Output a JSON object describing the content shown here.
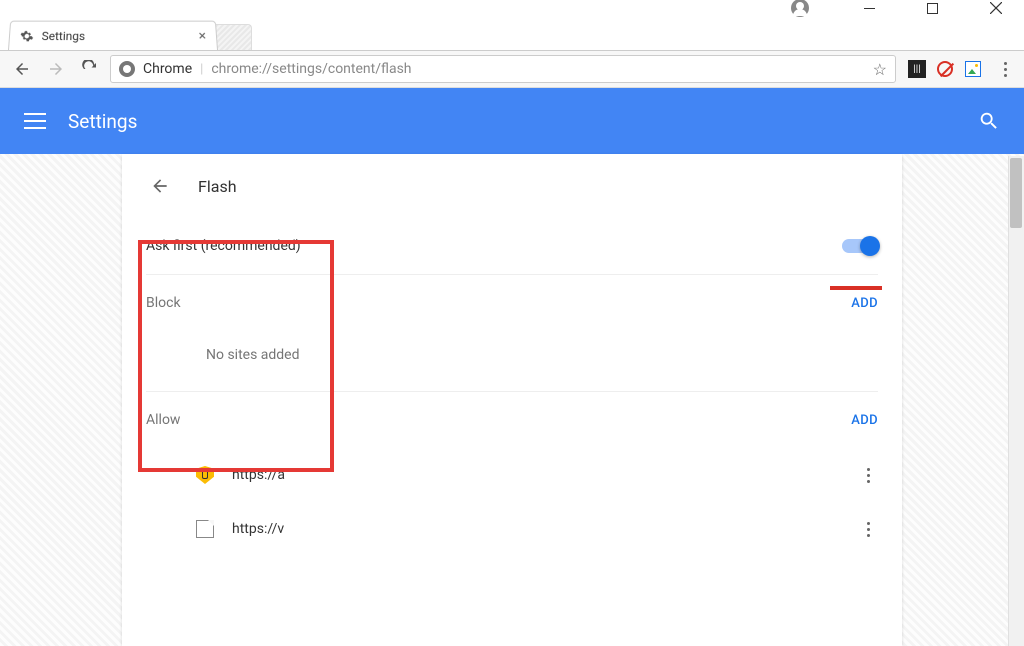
{
  "window": {
    "tab_title": "Settings"
  },
  "toolbar": {
    "url_label": "Chrome",
    "url_path": "chrome://settings/content/flash"
  },
  "header": {
    "title": "Settings"
  },
  "panel": {
    "title": "Flash",
    "ask_first_label": "Ask first (recommended)",
    "ask_first_toggle": true,
    "block_label": "Block",
    "block_add": "ADD",
    "block_empty": "No sites added",
    "allow_label": "Allow",
    "allow_add": "ADD",
    "allow_sites": [
      {
        "url": "https://a",
        "icon": "shield"
      },
      {
        "url": "https://v",
        "icon": "page"
      }
    ]
  }
}
